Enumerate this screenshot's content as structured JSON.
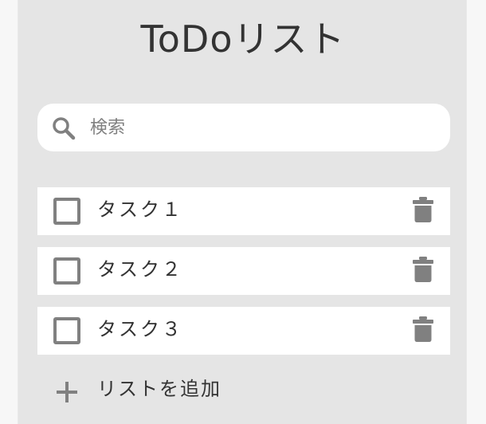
{
  "app": {
    "title": "ToDoリスト"
  },
  "search": {
    "placeholder": "検索",
    "value": "",
    "icon": "search-icon"
  },
  "tasks": [
    {
      "label": "タスク１",
      "checked": false,
      "delete_icon": "trash-icon"
    },
    {
      "label": "タスク２",
      "checked": false,
      "delete_icon": "trash-icon"
    },
    {
      "label": "タスク３",
      "checked": false,
      "delete_icon": "trash-icon"
    }
  ],
  "add": {
    "label": "リストを追加",
    "icon": "plus-icon"
  },
  "colors": {
    "page_background": "#f7f7f7",
    "panel_background": "#e5e5e5",
    "card_background": "#ffffff",
    "icon_gray": "#808080",
    "text": "#333333"
  }
}
